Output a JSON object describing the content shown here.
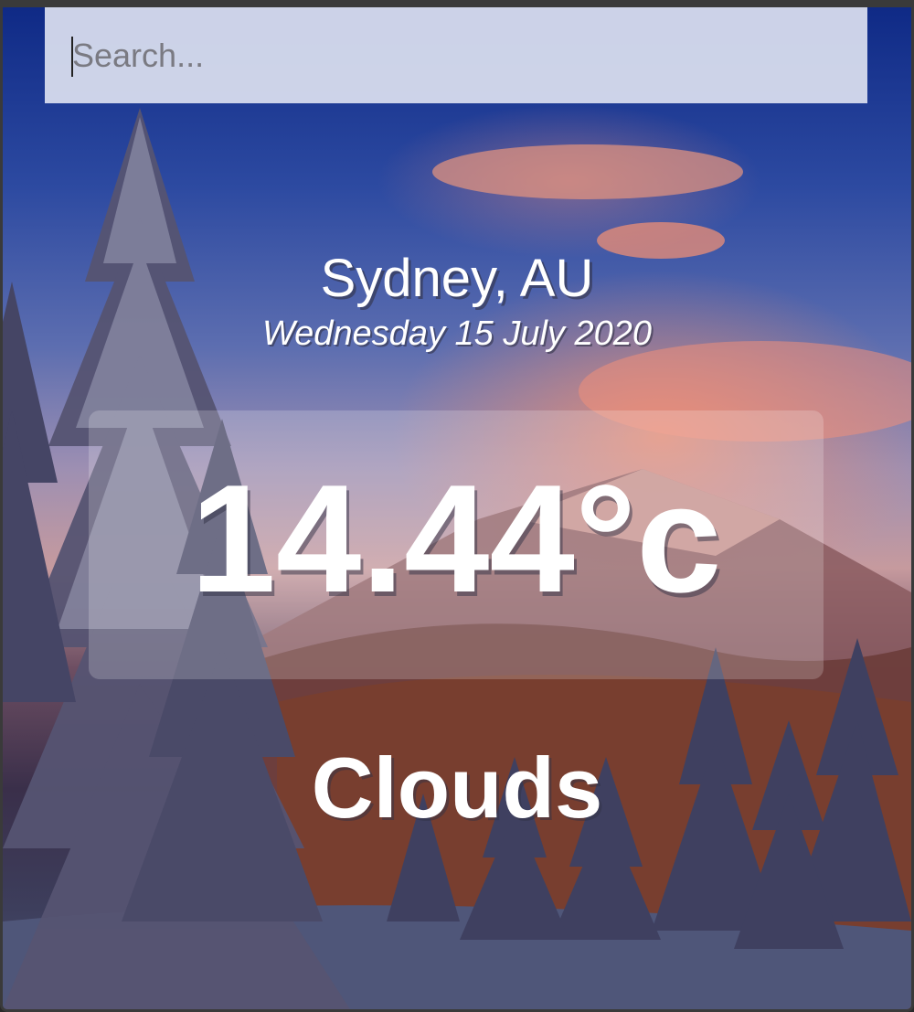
{
  "search": {
    "placeholder": "Search...",
    "value": ""
  },
  "location": {
    "city": "Sydney, AU",
    "date": "Wednesday 15 July 2020"
  },
  "weather": {
    "temperature": "14.44°c",
    "condition": "Clouds"
  },
  "background": {
    "icon": "winter-forest-background"
  },
  "colors": {
    "sky_top": "#0f2a86",
    "sunset_glow": "#ee8c6e",
    "text": "#ffffff",
    "search_bg": "#dce1f0"
  }
}
